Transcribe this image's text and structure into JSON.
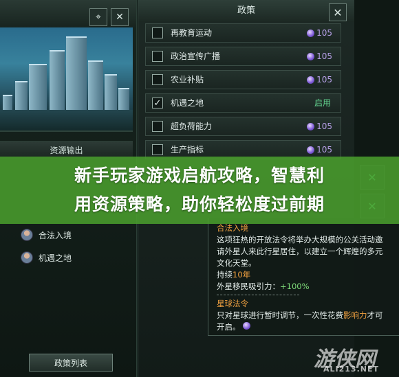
{
  "left_panel": {
    "resource_output_title": "资源输出",
    "entries": [
      {
        "label": "合法入境"
      },
      {
        "label": "机遇之地"
      }
    ],
    "policy_list_button": "政策列表"
  },
  "policy_panel": {
    "title": "政策",
    "rows": [
      {
        "label": "再教育运动",
        "checked": false,
        "cost": "105"
      },
      {
        "label": "政治宣传广播",
        "checked": false,
        "cost": "105"
      },
      {
        "label": "农业补贴",
        "checked": false,
        "cost": "105"
      },
      {
        "label": "机遇之地",
        "checked": true,
        "status": "启用"
      },
      {
        "label": "超负荷能力",
        "checked": false,
        "cost": "105"
      },
      {
        "label": "生产指标",
        "checked": false,
        "cost": "105"
      }
    ]
  },
  "detail": {
    "title": "合法入境",
    "desc_lines": [
      "这项狂热的开放法令将举办大规模的公关活动邀",
      "请外星人来此行星居住，以建立一个辉煌的多元",
      "文化天堂。"
    ],
    "duration_label": "持续",
    "duration_value": "10年",
    "effect_label": "外星移民吸引力：",
    "effect_value": "+100%",
    "section2_title": "星球法令",
    "section2_line1_a": "只对星球进行暂时调节，一次性花费",
    "section2_line1_b": "影响力",
    "section2_line1_c": "才可",
    "section2_line2": "开启。"
  },
  "banner": {
    "line1": "新手玩家游戏启航攻略，智慧利",
    "line2": "用资源策略，助你轻松度过前期"
  },
  "watermark": {
    "logo": "游侠网",
    "site": "ALI213.NET"
  },
  "colors": {
    "banner_green": "#4ba02d",
    "cost_purple": "#b7a0e8",
    "enabled_green": "#63d38f",
    "highlight_orange": "#f0a040"
  }
}
